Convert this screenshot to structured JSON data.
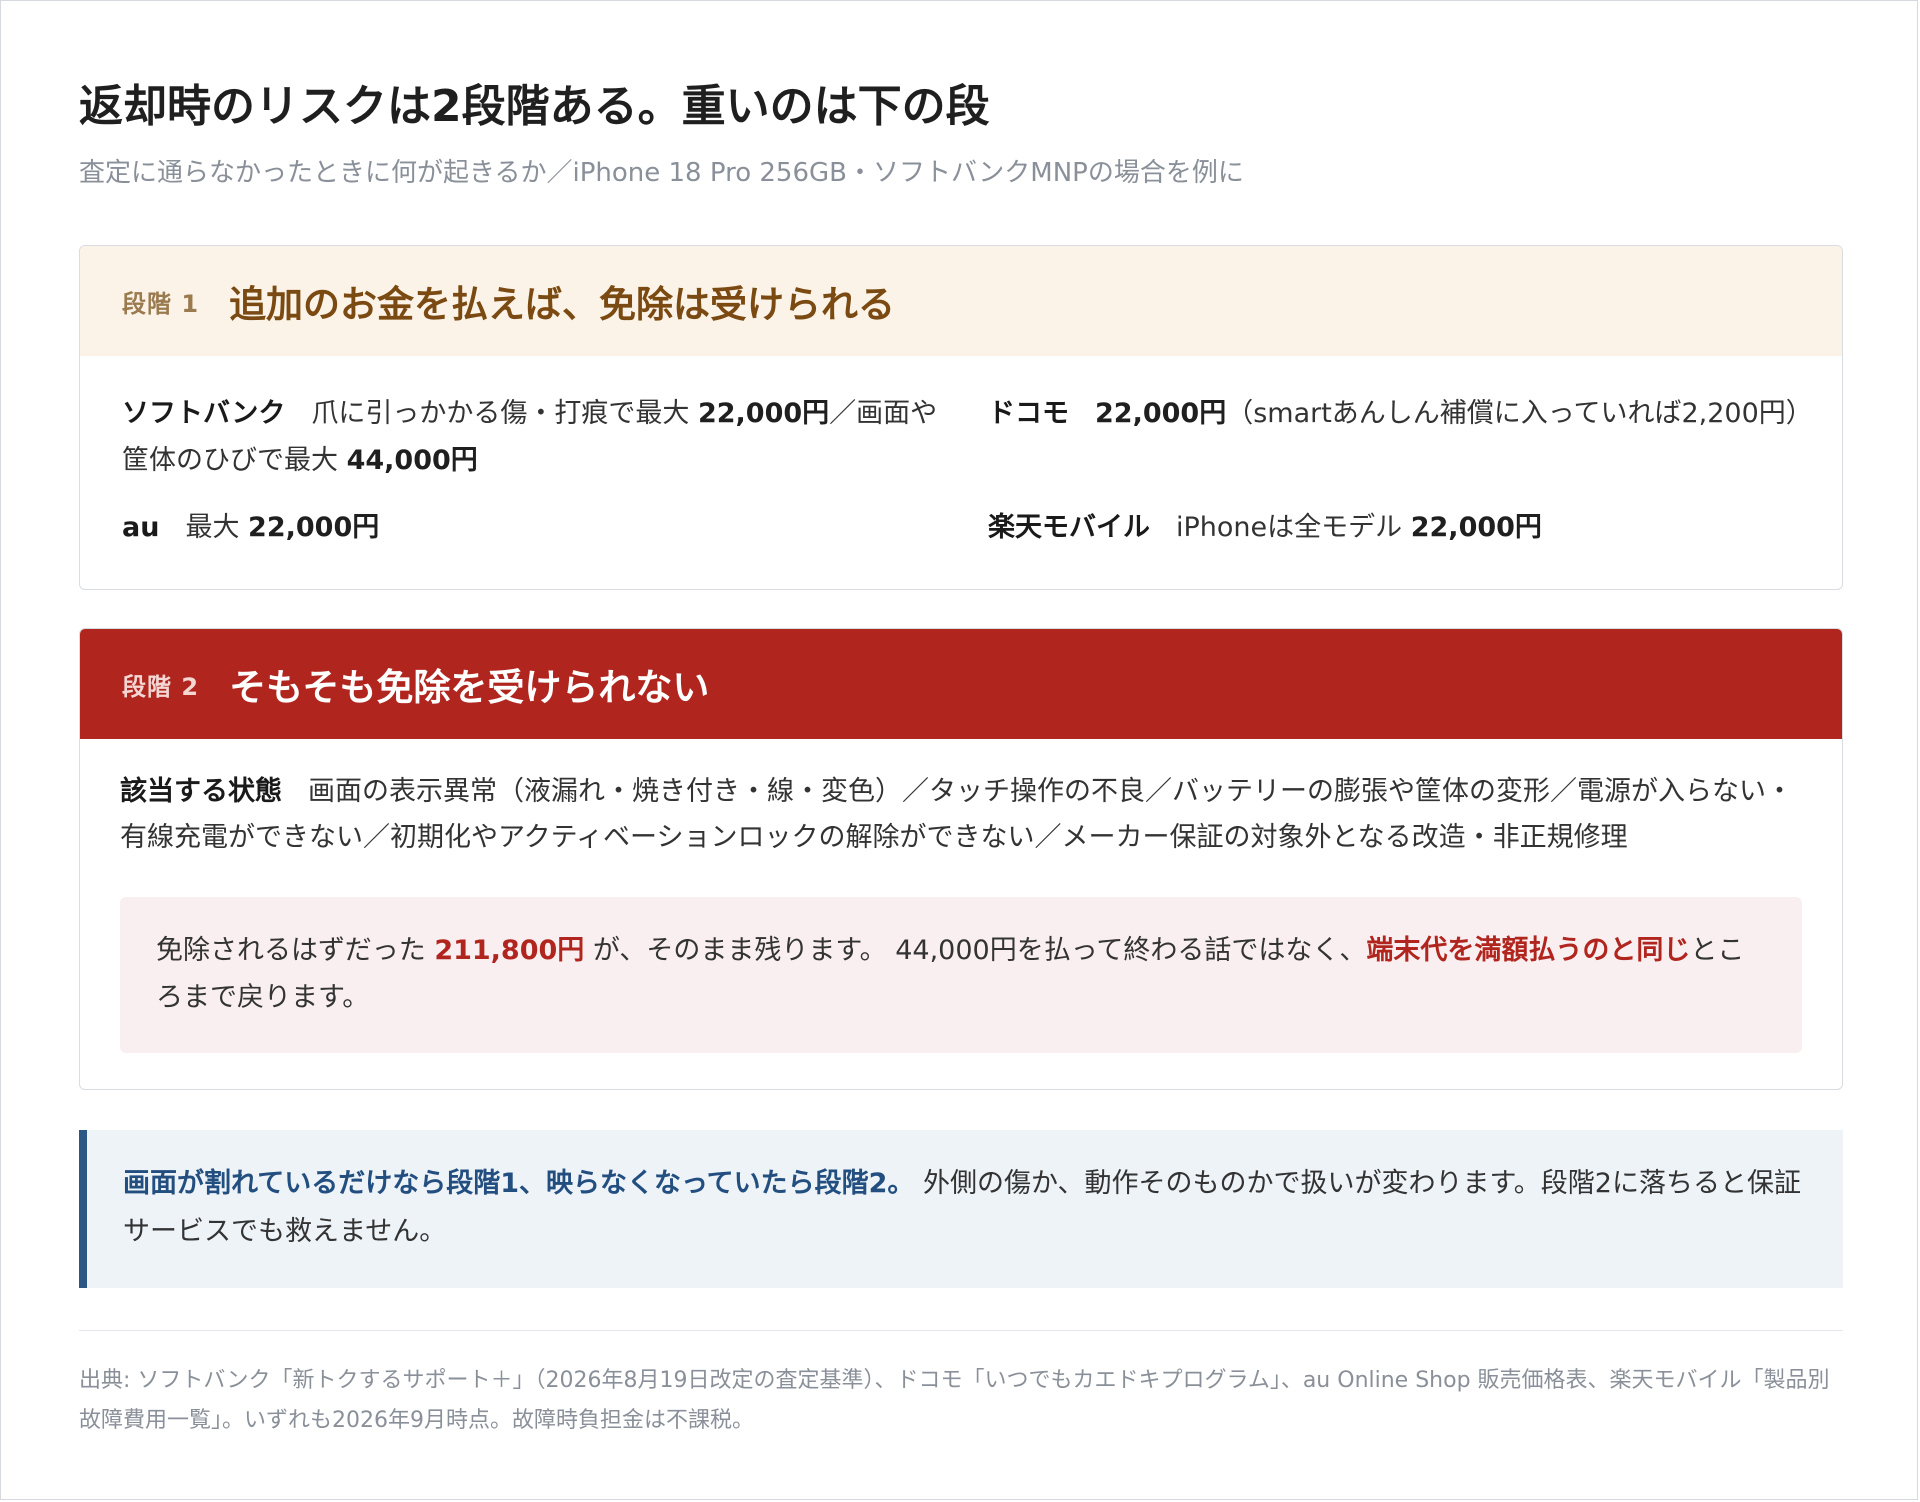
{
  "header": {
    "title": "返却時のリスクは2段階ある。重いのは下の段",
    "subtitle": "査定に通らなかったときに何が起きるか／iPhone 18 Pro 256GB・ソフトバンクMNPの場合を例に"
  },
  "stage1": {
    "label": "段階 1",
    "title": "追加のお金を払えば、免除は受けられる",
    "softbank": {
      "carrier": "ソフトバンク",
      "t1": "爪に引っかかる傷・打痕で最大 ",
      "v1": "22,000円",
      "t2": "／画面や筐体のひびで最大 ",
      "v2": "44,000円"
    },
    "docomo": {
      "carrier": "ドコモ",
      "v1": "22,000円",
      "t1": "（smartあんしん補償に入っていれば2,200円）"
    },
    "au": {
      "carrier": "au",
      "t1": "最大 ",
      "v1": "22,000円"
    },
    "rakuten": {
      "carrier": "楽天モバイル",
      "t1": "iPhoneは全モデル ",
      "v1": "22,000円"
    }
  },
  "stage2": {
    "label": "段階 2",
    "title": "そもそも免除を受けられない",
    "state_label": "該当する状態",
    "state_text": "画面の表示異常（液漏れ・焼き付き・線・変色）／タッチ操作の不良／バッテリーの膨張や筐体の変形／電源が入らない・有線充電ができない／初期化やアクティベーションロックの解除ができない／メーカー保証の対象外となる改造・非正規修理",
    "warning": {
      "t1": "免除されるはずだった ",
      "amount": "211,800円",
      "t2": " が、そのまま残ります。 44,000円を払って終わる話ではなく、",
      "emph": "端末代を満額払うのと同じ",
      "t3": "ところまで戻ります。"
    }
  },
  "note": {
    "strong": "画面が割れているだけなら段階1、映らなくなっていたら段階2。",
    "text": " 外側の傷か、動作そのものかで扱いが変わります。段階2に落ちると保証サービスでも救えません。"
  },
  "source": "出典: ソフトバンク「新トクするサポート＋」（2026年8月19日改定の査定基準）、ドコモ「いつでもカエドキプログラム」、au Online Shop 販売価格表、楽天モバイル「製品別故障費用一覧」。いずれも2026年9月時点。故障時負担金は不課税。",
  "colors": {
    "stage1_bg": "#fbf3e7",
    "stage2_bg": "#b1251f",
    "accent_red": "#b1251f",
    "note_blue": "#234f80"
  }
}
